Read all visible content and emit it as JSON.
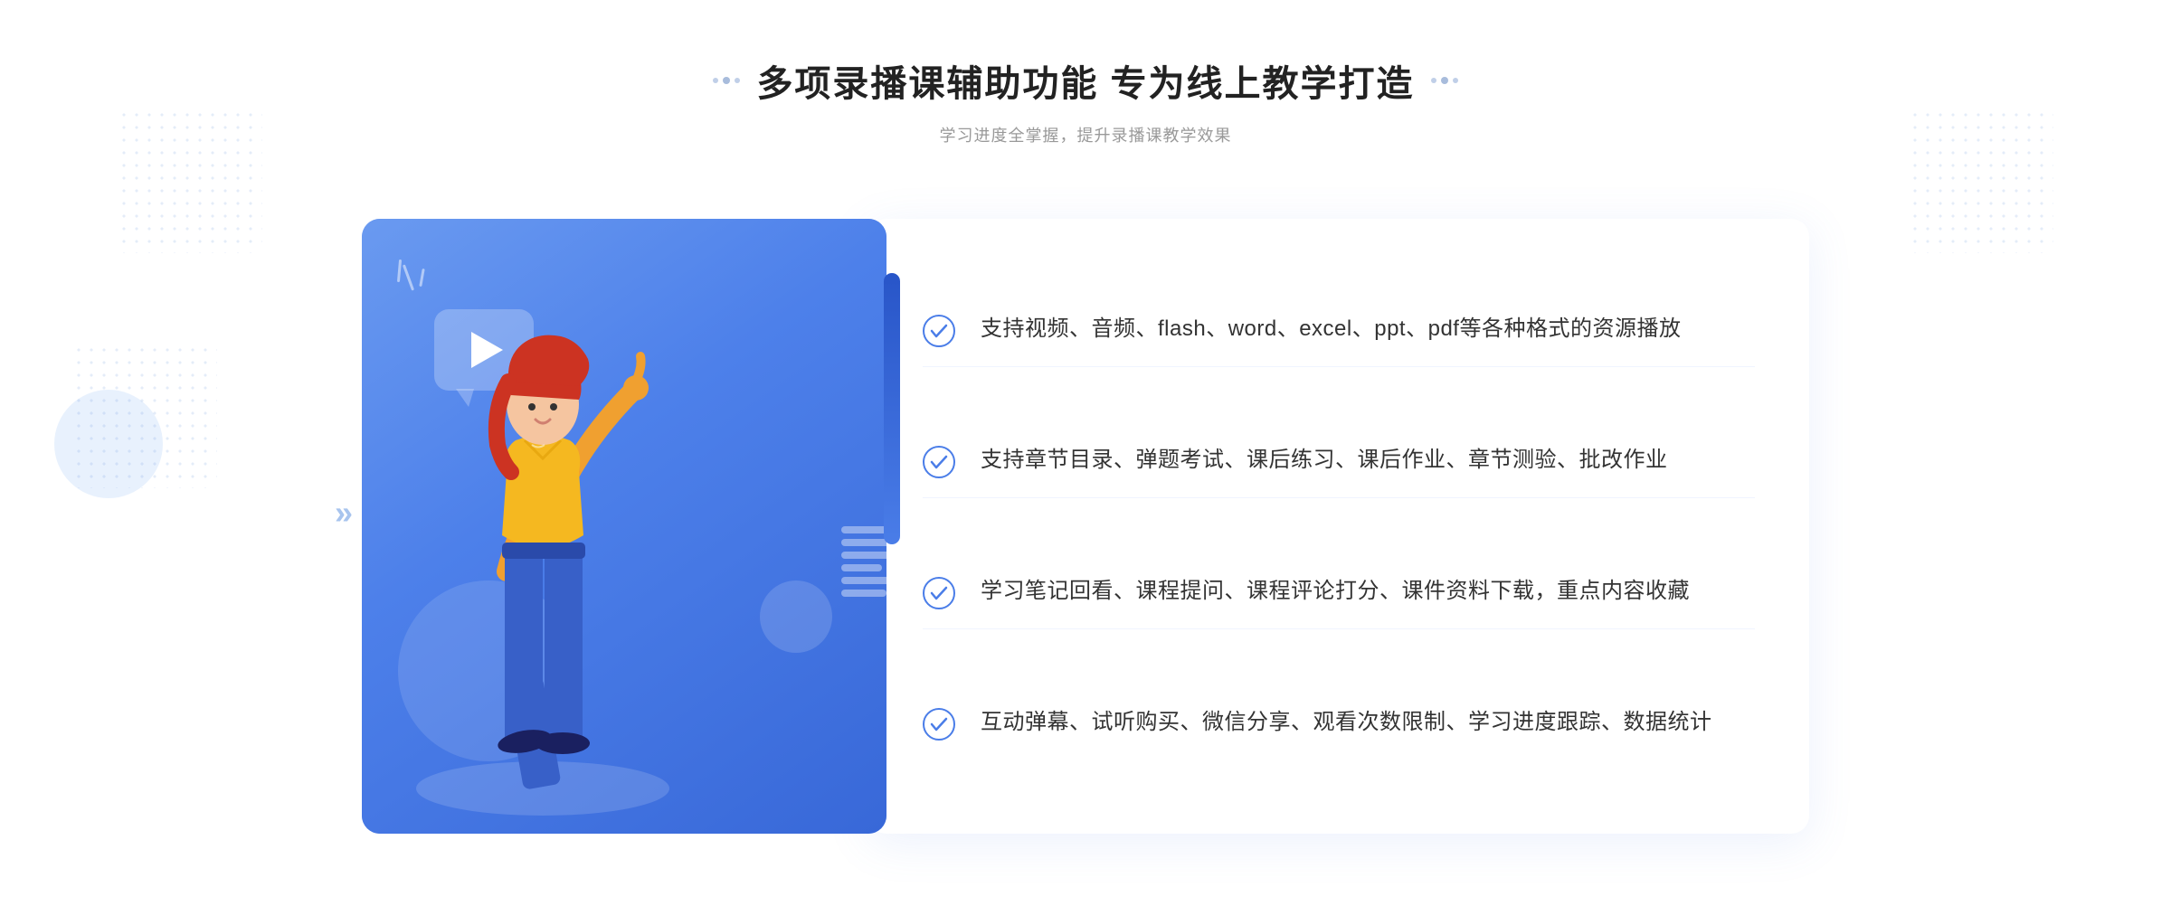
{
  "header": {
    "title": "多项录播课辅助功能 专为线上教学打造",
    "subtitle": "学习进度全掌握，提升录播课教学效果"
  },
  "features": [
    {
      "id": "feature-1",
      "text": "支持视频、音频、flash、word、excel、ppt、pdf等各种格式的资源播放"
    },
    {
      "id": "feature-2",
      "text": "支持章节目录、弹题考试、课后练习、课后作业、章节测验、批改作业"
    },
    {
      "id": "feature-3",
      "text": "学习笔记回看、课程提问、课程评论打分、课件资料下载，重点内容收藏"
    },
    {
      "id": "feature-4",
      "text": "互动弹幕、试听购买、微信分享、观看次数限制、学习进度跟踪、数据统计"
    }
  ],
  "colors": {
    "primary": "#4a7de8",
    "primary_dark": "#3260c8",
    "text_dark": "#222222",
    "text_medium": "#333333",
    "text_light": "#999999",
    "check_color": "#4a7de8"
  },
  "decorations": {
    "arrows_left": "»"
  }
}
